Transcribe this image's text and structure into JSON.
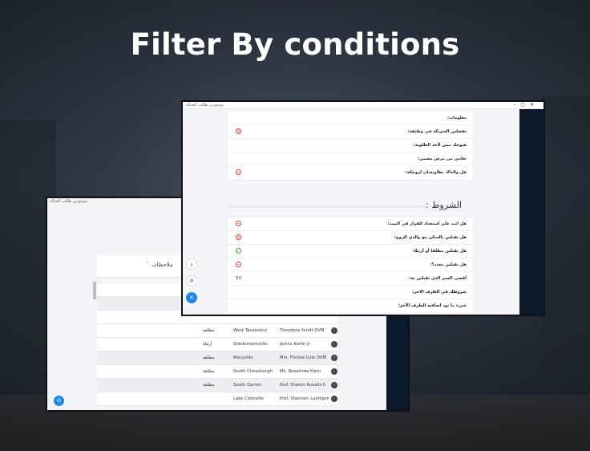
{
  "headline": "Filter By conditions",
  "back_window": {
    "title": "موجودين طالب العدالة",
    "notes_header": "ملاحظات",
    "rows": [
      {
        "status": "مطلقة",
        "city": "West Tavarestur",
        "name": "Theodora Yundt DVM",
        "bg": "white"
      },
      {
        "status": "أرملة",
        "city": "Stiedemannville",
        "name": "Janice Kiehn Jr.",
        "bg": "white"
      },
      {
        "status": "مطلقة",
        "city": "Macyville",
        "name": "Mrs. Florida Cole DVM",
        "bg": "gray"
      },
      {
        "status": "مطلقة",
        "city": "South Cheseburgh",
        "name": "Ms. Rosalinda Klein",
        "bg": "white"
      },
      {
        "status": "مطلقة",
        "city": "South Darren",
        "name": "Prof. Sharon Kuvalis II",
        "bg": "gray"
      },
      {
        "status": "",
        "city": "Lake Clotsville",
        "name": "Prof. Shannon Luettgen",
        "bg": "white"
      }
    ]
  },
  "front_window": {
    "title": "موجودين طالب العدالة",
    "top_card": [
      {
        "text": "معلومات:",
        "icon": ""
      },
      {
        "text": "تفضلين الشريكة في وظيفة:",
        "icon": "x-red"
      },
      {
        "text": "هيوحك ممن لأخذ الطلوبة:",
        "icon": ""
      },
      {
        "text": "تعانين من مرض مضمن:",
        "icon": ""
      },
      {
        "text": "هل والداك بطاونشان لزوجكة:",
        "icon": "minus-red"
      }
    ],
    "section_title": "الشروط :",
    "conditions_card": [
      {
        "text": "هل انت على استعداد للقرار في البيت:",
        "icon": "minus-red",
        "value": ""
      },
      {
        "text": "هل تقبلين بالسكن مع والدي الزوج:",
        "icon": "x-red",
        "value": ""
      },
      {
        "text": "هل تقبلين مطلقا أو أرملا:",
        "icon": "check-green",
        "value": ""
      },
      {
        "text": "هل تقبلين معدد؟:",
        "icon": "minus-red",
        "value": ""
      },
      {
        "text": "أقصى العمر الذي تقبلين به:",
        "icon": "",
        "value": "50"
      },
      {
        "text": "شروطك في الطرف الاخر:",
        "icon": "",
        "value": ""
      },
      {
        "text": "شيء ما تود اضافته للطرف الآخر:",
        "icon": "",
        "value": ""
      }
    ]
  },
  "fab_icons": [
    "download-icon",
    "block-icon",
    "close-icon"
  ],
  "colors": {
    "accent": "#1e88e5",
    "danger": "#e53935",
    "success": "#43a047",
    "sidebar": "#0c1a2c"
  }
}
